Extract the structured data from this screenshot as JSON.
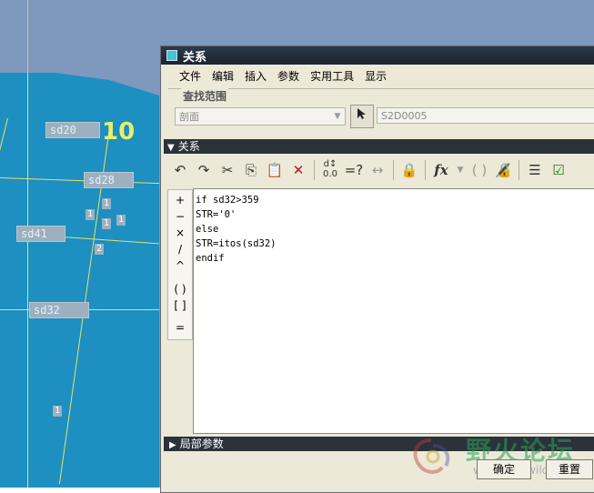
{
  "cad": {
    "tags": [
      "sd20",
      "sd28",
      "sd41",
      "sd32"
    ],
    "big_number": "10",
    "small_marks": [
      "1",
      "1",
      "1",
      "1",
      "2",
      "1"
    ]
  },
  "dialog": {
    "title": "关系",
    "menu": [
      "文件",
      "编辑",
      "插入",
      "参数",
      "实用工具",
      "显示"
    ],
    "lookup": {
      "label": "查找范围",
      "combo_value": "剖面",
      "selection": "S2D0005"
    },
    "relations_header": "关系",
    "toolbar_icons": [
      "undo-icon",
      "redo-icon",
      "cut-icon",
      "copy-icon",
      "paste-icon",
      "delete-icon",
      "units-icon",
      "evaluate-icon",
      "measure-icon",
      "lock-icon",
      "function-icon",
      "dropdown-icon",
      "brackets-icon",
      "parameter-lock-icon",
      "sort-icon",
      "verify-icon"
    ],
    "ops": [
      "+",
      "−",
      "×",
      "/",
      "^",
      "( )",
      "[ ]",
      "="
    ],
    "code_lines": [
      "if sd32>359",
      "STR='0'",
      "else",
      "STR=itos(sd32)",
      "endif"
    ],
    "local_params": "局部参数",
    "buttons": {
      "ok": "确定",
      "reset": "重置"
    }
  },
  "watermark": {
    "text": "野火论坛",
    "url": "www.proewildfire.cn"
  }
}
